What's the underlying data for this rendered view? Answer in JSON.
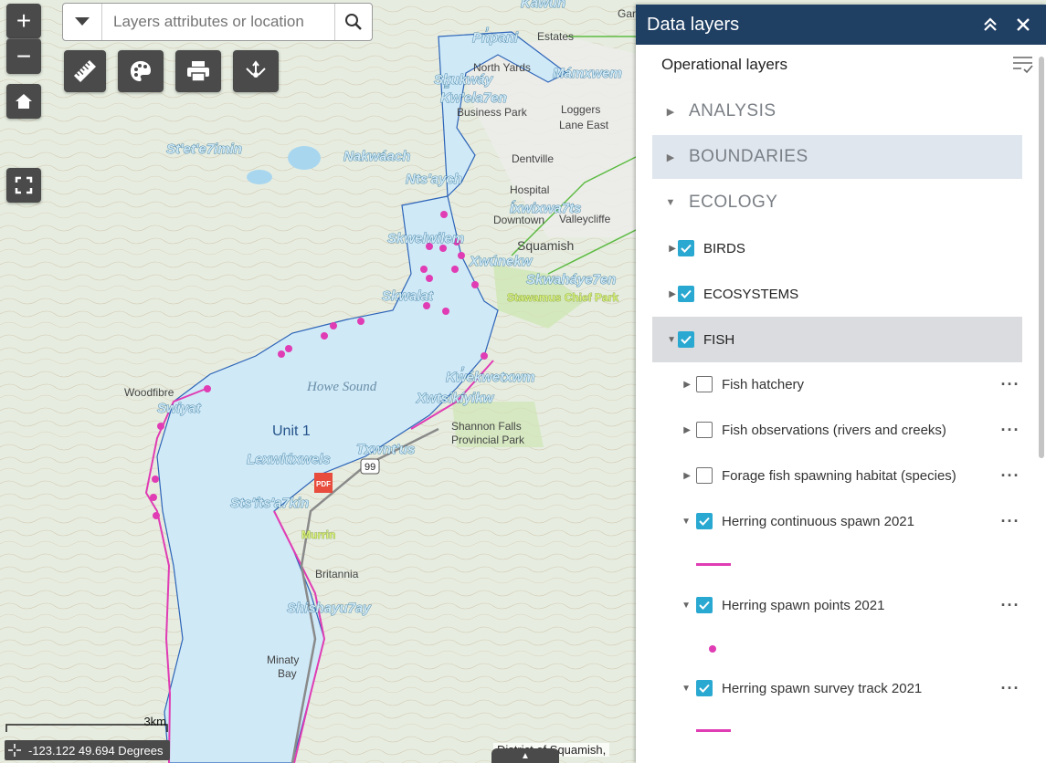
{
  "map": {
    "labels": {
      "kawun": "Kawun",
      "pi_pani": "Pn̓pani",
      "mamxwem": "Mámxwem",
      "slhukway": "Sḵ̱ukwáy",
      "kwelaen": "Kw'ela7en",
      "steteimin": "St'et'e7imin",
      "nakwaach": "Nakwáach",
      "ntsaych": "Nts'aych",
      "ixwixwa": "Íxwixwa7ts",
      "skwelwilem": "Skwelwilem",
      "xwunekw": "Xwúnekw",
      "skwahaye": "Skwaháye7en",
      "skwalat": "Skwalat",
      "kwekwe": "Kw̓ékwetxwm",
      "xwtsikiyikw": "Xwtsikíyikw",
      "swiyat": "Swiyat",
      "lexwlux": "Lexwlúxwels",
      "txwnus": "Txwnt'us",
      "stsits": "Sts'íts'a7kin",
      "shishayu": "Shishayu7ay",
      "howe": "Howe Sound",
      "unit1": "Unit 1",
      "north_yards": "North Yards",
      "business_park": "Business Park",
      "loggers_east": "Loggers\nLane East",
      "dentville": "Dentville",
      "hospital": "Hospital",
      "downtown": "Downtown",
      "valleycliffe": "Valleycliffe",
      "squamish": "Squamish",
      "stawamus": "Stawamus Chief Park",
      "shannon": "Shannon Falls",
      "provincial_park": "Provincial Park",
      "woodfibre": "Woodfibre",
      "murrin": "Murrin",
      "britannia": "Britannia",
      "minaty": "Minaty",
      "bay": "Bay",
      "garibaldi": "Garibaldi",
      "estates": "Estates",
      "highway": "99",
      "pdf": "PDF"
    }
  },
  "search": {
    "placeholder": "Layers attributes or location"
  },
  "scale": "3km",
  "coords": "-123.122 49.694 Degrees",
  "attribution": "District of Squamish,",
  "panel": {
    "title": "Data layers",
    "subheader": "Operational layers",
    "groups": [
      {
        "label": "ANALYSIS"
      },
      {
        "label": "BOUNDARIES"
      },
      {
        "label": "ECOLOGY"
      }
    ],
    "layers": [
      {
        "label": "BIRDS"
      },
      {
        "label": "ECOSYSTEMS"
      },
      {
        "label": "FISH"
      }
    ],
    "sublayers": [
      {
        "label": "Fish hatchery"
      },
      {
        "label": "Fish observations (rivers and creeks)"
      },
      {
        "label": "Forage fish spawning habitat (species)"
      },
      {
        "label": "Herring continuous spawn 2021"
      },
      {
        "label": "Herring spawn points 2021"
      },
      {
        "label": "Herring spawn survey track 2021"
      }
    ]
  },
  "colors": {
    "header": "#1f3f63",
    "checkbox": "#29a8d1",
    "herring": "#e03cb4",
    "water": "#cfe9f7",
    "boundary": "#2c63b8"
  }
}
